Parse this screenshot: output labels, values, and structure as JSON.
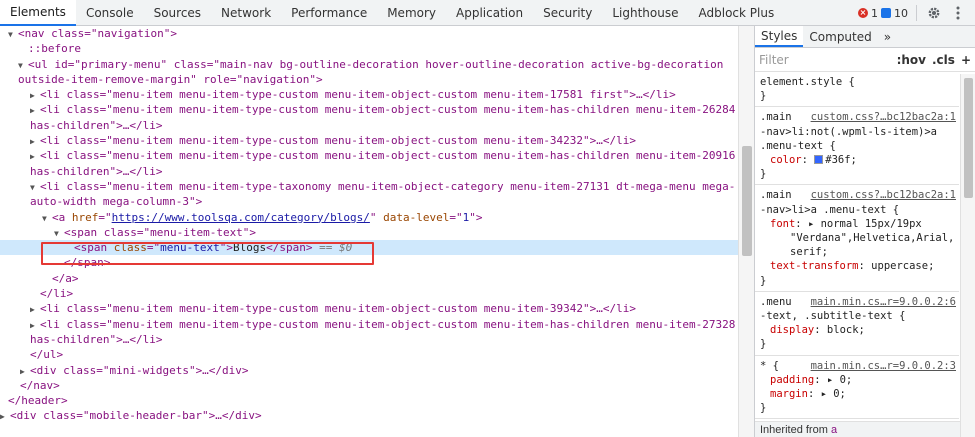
{
  "tabs": [
    "Elements",
    "Console",
    "Sources",
    "Network",
    "Performance",
    "Memory",
    "Application",
    "Security",
    "Lighthouse",
    "Adblock Plus"
  ],
  "active_tab": "Elements",
  "status": {
    "errors": "1",
    "messages": "10"
  },
  "icons": {
    "settings": "gear-icon",
    "more": "kebab-menu-icon"
  },
  "dom": {
    "line0": "<nav class=\"navigation\">",
    "line1": "::before",
    "line2a": "<ul id=\"primary-menu\" class=\"main-nav bg-outline-decoration hover-outline-decoration active-bg-decoration",
    "line2b": "outside-item-remove-margin\" role=\"navigation\">",
    "line3": "<li class=\"menu-item menu-item-type-custom menu-item-object-custom menu-item-17581 first\">…</li>",
    "line4a": "<li class=\"menu-item menu-item-type-custom menu-item-object-custom menu-item-has-children menu-item-26284",
    "line4b": "has-children\">…</li>",
    "line5": "<li class=\"menu-item menu-item-type-custom menu-item-object-custom menu-item-34232\">…</li>",
    "line6a": "<li class=\"menu-item menu-item-type-custom menu-item-object-custom menu-item-has-children menu-item-20916",
    "line6b": "has-children\">…</li>",
    "line7a": "<li class=\"menu-item menu-item-type-taxonomy menu-item-object-category menu-item-27131 dt-mega-menu mega-",
    "line7b": "auto-width mega-column-3\">",
    "line8_url": "https://www.toolsqa.com/category/blogs/",
    "line9": "<span class=\"menu-item-text\">",
    "line10_text": "Blogs",
    "line10_dollar": "== $0",
    "line11": "</span>",
    "line12": "</a>",
    "line13": "</li>",
    "line14": "<li class=\"menu-item menu-item-type-custom menu-item-object-custom menu-item-39342\">…</li>",
    "line15a": "<li class=\"menu-item menu-item-type-custom menu-item-object-custom menu-item-has-children menu-item-27328",
    "line15b": "has-children\">…</li>",
    "line16": "</ul>",
    "line17": "<div class=\"mini-widgets\">…</div>",
    "line18": "</nav>",
    "line19": "</header>",
    "line20": "<div class=\"mobile-header-bar\">…</div>"
  },
  "styles": {
    "tabs": [
      "Styles",
      "Computed"
    ],
    "more": "»",
    "filter_placeholder": "Filter",
    "hov": ":hov",
    "cls": ".cls",
    "add": "+",
    "rules": {
      "r0_sel": "element.style {",
      "r0_end": "}",
      "r1_sel1": ".main",
      "r1_src": "custom.css?…bc12bac2a:1",
      "r1_sel2": "-nav>li:not(.wpml-ls-item)>a",
      "r1_sel3": ".menu-text {",
      "r1_prop": "color",
      "r1_val": "#36f;",
      "r1_end": "}",
      "r2_sel1": ".main",
      "r2_src": "custom.css?…bc12bac2a:1",
      "r2_sel2": "-nav>li>a .menu-text {",
      "r2_prop": "font",
      "r2_val1": "▸ normal 15px/19px",
      "r2_val2": "\"Verdana\",Helvetica,Arial,",
      "r2_val3": "serif;",
      "r2_prop2": "text-transform",
      "r2_val4": "uppercase;",
      "r2_end": "}",
      "r3_sel1": ".menu",
      "r3_src": "main.min.cs…r=9.0.0.2:6",
      "r3_sel2": "-text, .subtitle-text {",
      "r3_prop": "display",
      "r3_val": "block;",
      "r3_end": "}",
      "r4_sel1": "* {",
      "r4_src": "main.min.cs…r=9.0.0.2:3",
      "r4_prop1": "padding",
      "r4_val1": "▸ 0;",
      "r4_prop2": "margin",
      "r4_val2": "▸ 0;",
      "r4_end": "}"
    },
    "inherited_label": "Inherited from",
    "inherited_link": "a"
  },
  "colors": {
    "accent": "#1a73e8",
    "highlight_box": "#e53935",
    "selected_row": "#cfe8fc",
    "swatch": "#3366ff"
  }
}
